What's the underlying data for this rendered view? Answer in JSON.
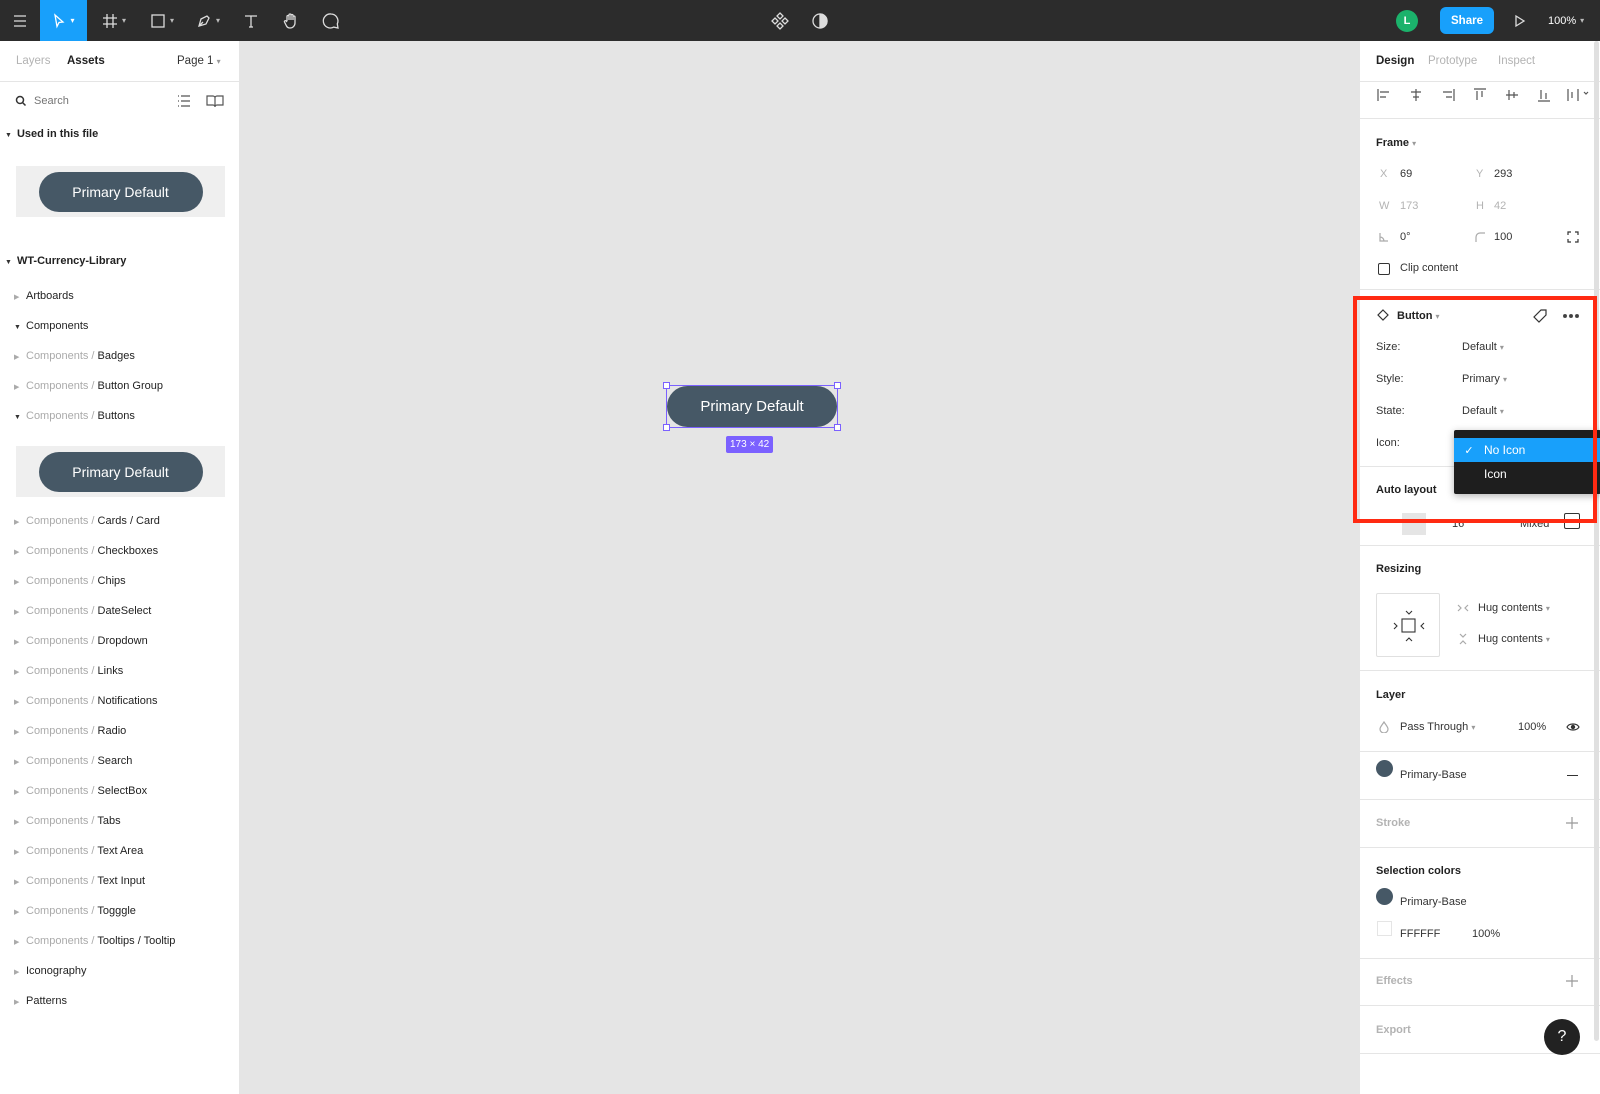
{
  "toolbar": {
    "share_label": "Share",
    "zoom": "100%",
    "avatar_initial": "L"
  },
  "sidebar": {
    "tabs": [
      "Layers",
      "Assets"
    ],
    "page": "Page 1",
    "search_placeholder": "Search",
    "used_section": "Used in this file",
    "thumb_label": "Primary Default",
    "library_name": "WT-Currency-Library",
    "items": [
      {
        "pre": "",
        "name": "Artboards",
        "open": false
      },
      {
        "pre": "",
        "name": "Components",
        "open": true
      },
      {
        "pre": "Components / ",
        "name": "Badges",
        "open": false
      },
      {
        "pre": "Components / ",
        "name": "Button Group",
        "open": false
      },
      {
        "pre": "Components / ",
        "name": "Buttons",
        "open": true
      },
      {
        "pre": "Components / ",
        "name": "Cards / Card",
        "open": false
      },
      {
        "pre": "Components / ",
        "name": "Checkboxes",
        "open": false
      },
      {
        "pre": "Components / ",
        "name": "Chips",
        "open": false
      },
      {
        "pre": "Components / ",
        "name": "DateSelect",
        "open": false
      },
      {
        "pre": "Components / ",
        "name": "Dropdown",
        "open": false
      },
      {
        "pre": "Components / ",
        "name": "Links",
        "open": false
      },
      {
        "pre": "Components / ",
        "name": "Notifications",
        "open": false
      },
      {
        "pre": "Components / ",
        "name": "Radio",
        "open": false
      },
      {
        "pre": "Components / ",
        "name": "Search",
        "open": false
      },
      {
        "pre": "Components / ",
        "name": "SelectBox",
        "open": false
      },
      {
        "pre": "Components / ",
        "name": "Tabs",
        "open": false
      },
      {
        "pre": "Components / ",
        "name": "Text Area",
        "open": false
      },
      {
        "pre": "Components / ",
        "name": "Text Input",
        "open": false
      },
      {
        "pre": "Components / ",
        "name": "Togggle",
        "open": false
      },
      {
        "pre": "Components / ",
        "name": "Tooltips / Tooltip",
        "open": false
      },
      {
        "pre": "",
        "name": "Iconography",
        "open": false
      },
      {
        "pre": "",
        "name": "Patterns",
        "open": false
      }
    ]
  },
  "canvas": {
    "button_label": "Primary Default",
    "size_badge": "173 × 42"
  },
  "panel": {
    "tabs": [
      "Design",
      "Prototype",
      "Inspect"
    ],
    "frame": {
      "title": "Frame",
      "x_label": "X",
      "x": "69",
      "y_label": "Y",
      "y": "293",
      "w_label": "W",
      "w": "173",
      "h_label": "H",
      "h": "42",
      "rotation": "0°",
      "radius": "100",
      "clip_label": "Clip content"
    },
    "component": {
      "title": "Button",
      "props": [
        {
          "label": "Size:",
          "value": "Default"
        },
        {
          "label": "Style:",
          "value": "Primary"
        },
        {
          "label": "State:",
          "value": "Default"
        },
        {
          "label": "Icon:",
          "value": ""
        }
      ],
      "dropdown": {
        "selected": "No Icon",
        "other": "Icon"
      }
    },
    "auto_layout": {
      "title": "Auto layout",
      "spacing": "16",
      "padding": "Mixed"
    },
    "resizing": {
      "title": "Resizing",
      "horizontal": "Hug contents",
      "vertical": "Hug contents"
    },
    "layer": {
      "title": "Layer",
      "blend": "Pass Through",
      "opacity": "100%"
    },
    "fill": {
      "name": "Primary-Base"
    },
    "stroke": {
      "title": "Stroke"
    },
    "selection_colors": {
      "title": "Selection colors",
      "color1": "Primary-Base",
      "color2": "FFFFFF",
      "color2_opacity": "100%"
    },
    "effects": {
      "title": "Effects"
    },
    "export": {
      "title": "Export"
    }
  },
  "colors": {
    "accent": "#18a0fb",
    "highlight_box": "#ff2a12",
    "button_fill": "#465866",
    "selection": "#7b61ff",
    "avatar": "#1bb26b"
  }
}
